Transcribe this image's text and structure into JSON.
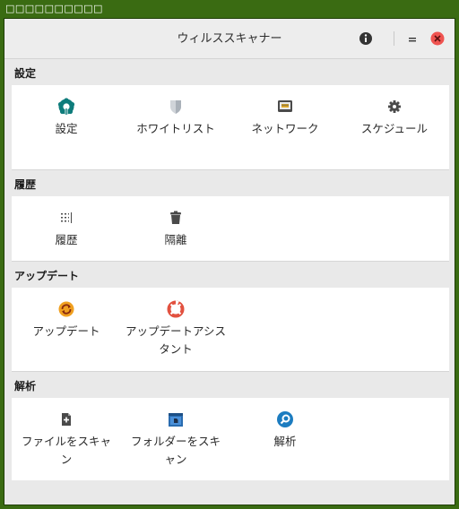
{
  "outer_title": "□□□□□□□□□□",
  "window": {
    "title": "ウィルススキャナー",
    "buttons": {
      "info": "info-icon",
      "minimize": "minimize-icon",
      "close": "close-icon"
    }
  },
  "sections": [
    {
      "title": "設定",
      "items": [
        {
          "label": "設定",
          "icon": "settings-gear-icon"
        },
        {
          "label": "ホワイトリスト",
          "icon": "shield-icon"
        },
        {
          "label": "ネットワーク",
          "icon": "network-icon"
        },
        {
          "label": "スケジュール",
          "icon": "gear-icon"
        }
      ]
    },
    {
      "title": "履歴",
      "items": [
        {
          "label": "履歴",
          "icon": "history-list-icon"
        },
        {
          "label": "隔離",
          "icon": "trash-icon"
        }
      ]
    },
    {
      "title": "アップデート",
      "items": [
        {
          "label": "アップデート",
          "icon": "refresh-icon"
        },
        {
          "label": "アップデートアシスタント",
          "icon": "lifebuoy-icon"
        }
      ]
    },
    {
      "title": "解析",
      "items": [
        {
          "label": "ファイルをスキャン",
          "icon": "file-plus-icon"
        },
        {
          "label": "フォルダーをスキャン",
          "icon": "folder-icon"
        },
        {
          "label": "解析",
          "icon": "magnifier-icon"
        }
      ]
    }
  ],
  "colors": {
    "desktop": "#3a6b12",
    "teal": "#0e7c7b",
    "orange": "#f0a020",
    "red": "#e2513f",
    "blue": "#2a7fc4",
    "close": "#ef5350"
  }
}
